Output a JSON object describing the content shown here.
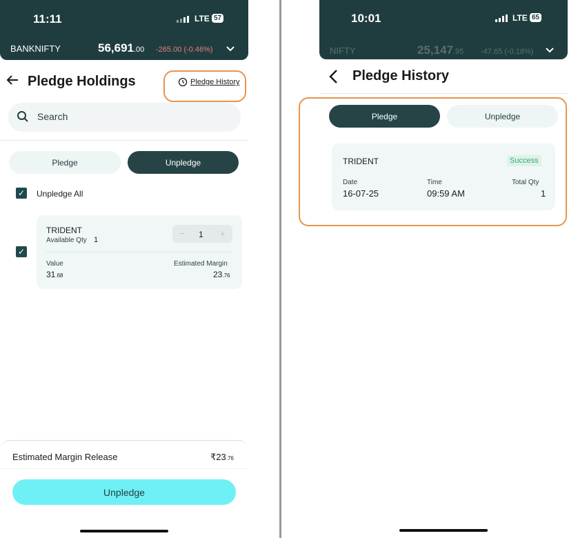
{
  "left": {
    "status": {
      "time": "11:11",
      "network": "LTE",
      "battery": "57"
    },
    "ticker": {
      "name": "BANKNIFTY",
      "price_main": "56,691",
      "price_decimal": ".00",
      "change": "-265.00 (-0.46%)"
    },
    "title": "Pledge Holdings",
    "history_link": "Pledge History",
    "search_placeholder": "Search",
    "tabs": {
      "pledge": "Pledge",
      "unpledge": "Unpledge"
    },
    "unpledge_all": "Unpledge All",
    "holding": {
      "name": "TRIDENT",
      "available_label": "Available Qty",
      "available_qty": "1",
      "stepper_value": "1",
      "minus": "−",
      "plus": "+",
      "value_label": "Value",
      "value_main": "31",
      "value_dec": ".68",
      "margin_label": "Estimated Margin",
      "margin_main": "23",
      "margin_dec": ".76"
    },
    "footer": {
      "label": "Estimated Margin Release",
      "amount_main": "₹23",
      "amount_dec": ".76",
      "button": "Unpledge"
    }
  },
  "right": {
    "status": {
      "time": "10:01",
      "network": "LTE",
      "battery": "65"
    },
    "ticker": {
      "name": "NIFTY",
      "price_main": "25,147",
      "price_decimal": ".95",
      "change": "-47.65 (-0.18%)"
    },
    "title": "Pledge History",
    "tabs": {
      "pledge": "Pledge",
      "unpledge": "Unpledge"
    },
    "record": {
      "name": "TRIDENT",
      "status": "Success",
      "date_label": "Date",
      "date": "16-07-25",
      "time_label": "Time",
      "time": "09:59 AM",
      "qty_label": "Total Qty",
      "qty": "1"
    }
  },
  "colors": {
    "header": "#1f3d3f",
    "accent": "#6ff0f5",
    "highlight": "#e8934a",
    "success": "#3aa873"
  }
}
